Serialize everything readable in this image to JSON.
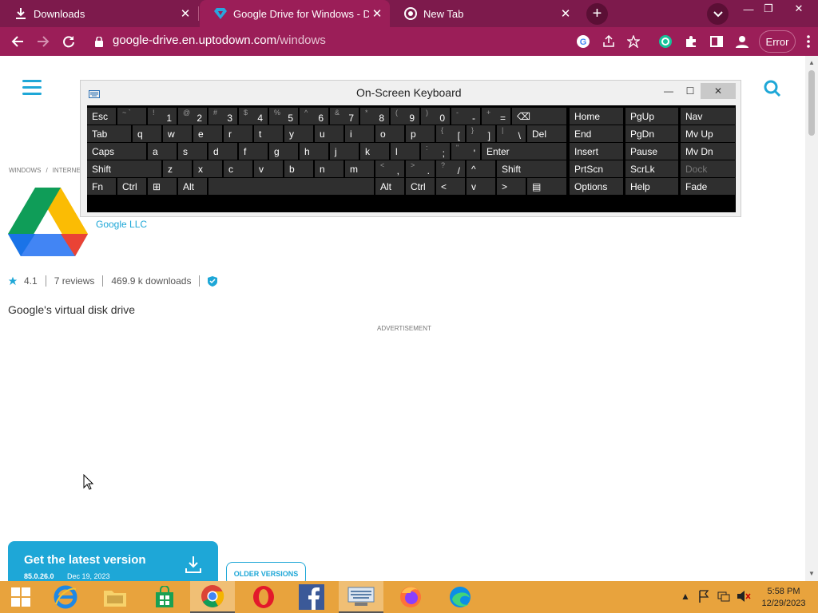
{
  "browser": {
    "tabs": [
      {
        "label": "Downloads",
        "icon": "download-icon",
        "active": false
      },
      {
        "label": "Google Drive for Windows - Dow",
        "icon": "uptodown-icon",
        "active": true
      },
      {
        "label": "New Tab",
        "icon": "chrome-icon",
        "active": false
      }
    ],
    "url_domain": "google-drive.en.uptodown.com",
    "url_path": "/windows",
    "error_button": "Error",
    "theme_color": "#9b1e58"
  },
  "page": {
    "breadcrumb": [
      "WINDOWS",
      "INTERNE"
    ],
    "developer": "Google LLC",
    "rating": "4.1",
    "reviews": "7 reviews",
    "downloads": "469.9 k downloads",
    "tagline": "Google's virtual disk drive",
    "ad_label": "ADVERTISEMENT",
    "get_latest": {
      "title": "Get the latest version",
      "version": "85.0.26.0",
      "date": "Dec 19, 2023"
    },
    "older_versions": "OLDER VERSIONS",
    "accent_color": "#1ea7d7"
  },
  "osk": {
    "title": "On-Screen Keyboard",
    "rows": [
      [
        {
          "shift": "",
          "main": "Esc",
          "base": ""
        },
        {
          "shift": "~ `",
          "main": "",
          "base": ""
        },
        {
          "shift": "!",
          "main": "",
          "base": "1"
        },
        {
          "shift": "@",
          "main": "",
          "base": "2"
        },
        {
          "shift": "#",
          "main": "",
          "base": "3"
        },
        {
          "shift": "$",
          "main": "",
          "base": "4"
        },
        {
          "shift": "%",
          "main": "",
          "base": "5"
        },
        {
          "shift": "^",
          "main": "",
          "base": "6"
        },
        {
          "shift": "&",
          "main": "",
          "base": "7"
        },
        {
          "shift": "*",
          "main": "",
          "base": "8"
        },
        {
          "shift": "(",
          "main": "",
          "base": "9"
        },
        {
          "shift": ")",
          "main": "",
          "base": "0"
        },
        {
          "shift": "-",
          "main": "",
          "base": "-"
        },
        {
          "shift": "+",
          "main": "",
          "base": "="
        },
        {
          "shift": "",
          "main": "⌫",
          "base": ""
        }
      ],
      [
        {
          "shift": "",
          "main": "Tab",
          "base": ""
        },
        {
          "shift": "",
          "main": "q",
          "base": ""
        },
        {
          "shift": "",
          "main": "w",
          "base": ""
        },
        {
          "shift": "",
          "main": "e",
          "base": ""
        },
        {
          "shift": "",
          "main": "r",
          "base": ""
        },
        {
          "shift": "",
          "main": "t",
          "base": ""
        },
        {
          "shift": "",
          "main": "y",
          "base": ""
        },
        {
          "shift": "",
          "main": "u",
          "base": ""
        },
        {
          "shift": "",
          "main": "i",
          "base": ""
        },
        {
          "shift": "",
          "main": "o",
          "base": ""
        },
        {
          "shift": "",
          "main": "p",
          "base": ""
        },
        {
          "shift": "{",
          "main": "",
          "base": "["
        },
        {
          "shift": "}",
          "main": "",
          "base": "]"
        },
        {
          "shift": "|",
          "main": "",
          "base": "\\"
        },
        {
          "shift": "",
          "main": "Del",
          "base": ""
        }
      ],
      [
        {
          "shift": "",
          "main": "Caps",
          "base": ""
        },
        {
          "shift": "",
          "main": "a",
          "base": ""
        },
        {
          "shift": "",
          "main": "s",
          "base": ""
        },
        {
          "shift": "",
          "main": "d",
          "base": ""
        },
        {
          "shift": "",
          "main": "f",
          "base": ""
        },
        {
          "shift": "",
          "main": "g",
          "base": ""
        },
        {
          "shift": "",
          "main": "h",
          "base": ""
        },
        {
          "shift": "",
          "main": "j",
          "base": ""
        },
        {
          "shift": "",
          "main": "k",
          "base": ""
        },
        {
          "shift": "",
          "main": "l",
          "base": ""
        },
        {
          "shift": ":",
          "main": "",
          "base": ";"
        },
        {
          "shift": "\"",
          "main": "",
          "base": "'"
        },
        {
          "shift": "",
          "main": "Enter",
          "base": ""
        }
      ],
      [
        {
          "shift": "",
          "main": "Shift",
          "base": ""
        },
        {
          "shift": "",
          "main": "z",
          "base": ""
        },
        {
          "shift": "",
          "main": "x",
          "base": ""
        },
        {
          "shift": "",
          "main": "c",
          "base": ""
        },
        {
          "shift": "",
          "main": "v",
          "base": ""
        },
        {
          "shift": "",
          "main": "b",
          "base": ""
        },
        {
          "shift": "",
          "main": "n",
          "base": ""
        },
        {
          "shift": "",
          "main": "m",
          "base": ""
        },
        {
          "shift": "<",
          "main": "",
          "base": ","
        },
        {
          "shift": ">",
          "main": "",
          "base": "."
        },
        {
          "shift": "?",
          "main": "",
          "base": "/"
        },
        {
          "shift": "",
          "main": "^",
          "base": ""
        },
        {
          "shift": "",
          "main": "Shift",
          "base": ""
        }
      ],
      [
        {
          "shift": "",
          "main": "Fn",
          "base": ""
        },
        {
          "shift": "",
          "main": "Ctrl",
          "base": ""
        },
        {
          "shift": "",
          "main": "⊞",
          "base": ""
        },
        {
          "shift": "",
          "main": "Alt",
          "base": ""
        },
        {
          "shift": "",
          "main": "",
          "base": ""
        },
        {
          "shift": "",
          "main": "Alt",
          "base": ""
        },
        {
          "shift": "",
          "main": "Ctrl",
          "base": ""
        },
        {
          "shift": "",
          "main": "<",
          "base": ""
        },
        {
          "shift": "",
          "main": "v",
          "base": ""
        },
        {
          "shift": "",
          "main": ">",
          "base": ""
        },
        {
          "shift": "",
          "main": "▤",
          "base": ""
        }
      ]
    ],
    "nav_keys": [
      [
        "Home",
        "PgUp",
        "Nav"
      ],
      [
        "End",
        "PgDn",
        "Mv Up"
      ],
      [
        "Insert",
        "Pause",
        "Mv Dn"
      ],
      [
        "PrtScn",
        "ScrLk",
        "Dock"
      ],
      [
        "Options",
        "Help",
        "Fade"
      ]
    ]
  },
  "taskbar": {
    "items": [
      "start-button",
      "internet-explorer-icon",
      "file-explorer-icon",
      "store-icon",
      "chrome-icon",
      "opera-icon",
      "facebook-icon",
      "osk-icon",
      "firefox-icon",
      "edge-icon"
    ],
    "time": "5:58 PM",
    "date": "12/29/2023",
    "color": "#e8a33d"
  }
}
